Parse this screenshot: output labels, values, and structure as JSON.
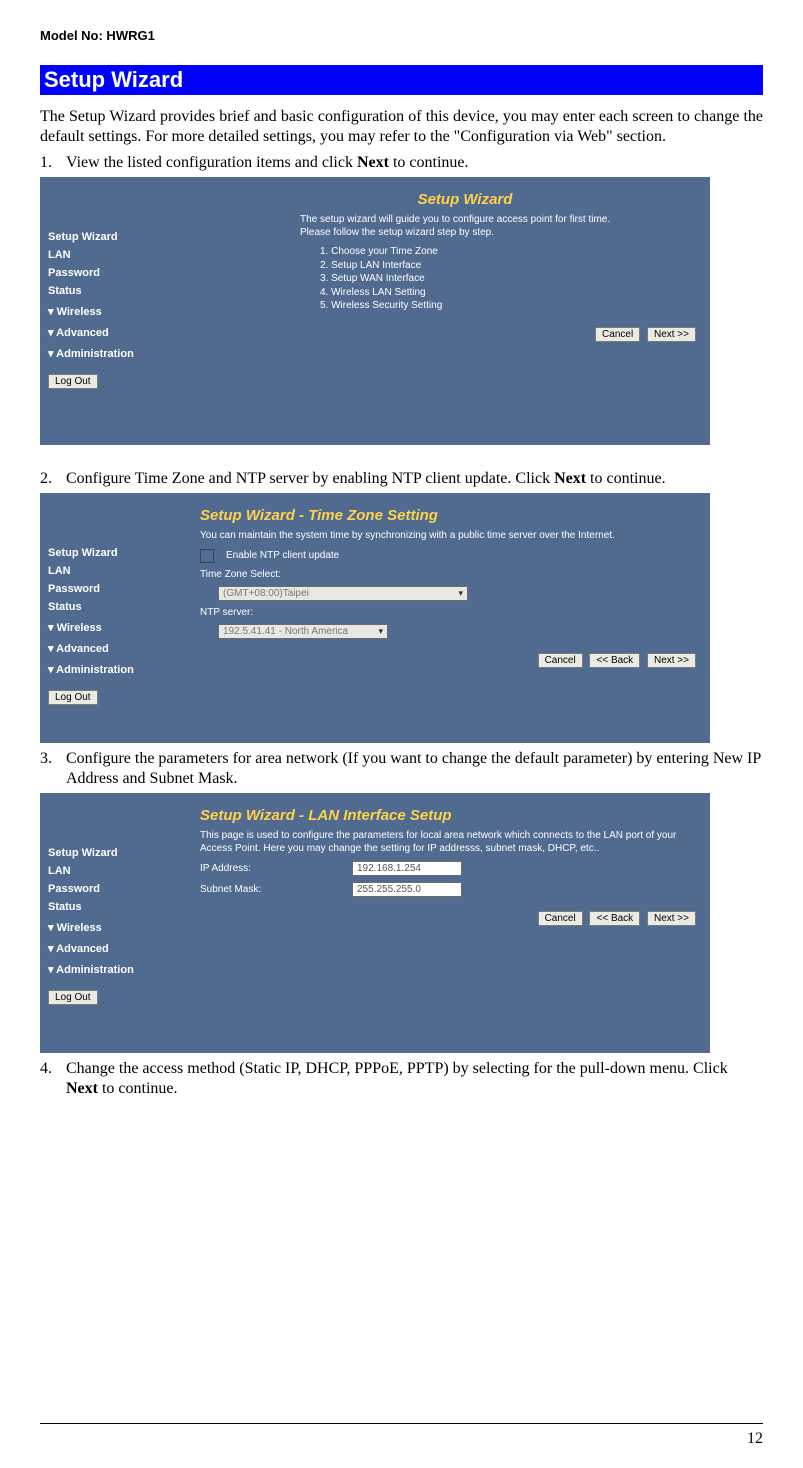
{
  "header": {
    "model": "Model No: HWRG1"
  },
  "banner": "Setup Wizard",
  "intro": "The Setup Wizard provides brief and basic configuration of this device, you may enter each screen to change the default settings.  For more detailed settings, you may refer to the \"Configuration via Web\" section.",
  "items": {
    "1": {
      "num": "1.",
      "pre": "View the listed configuration items and click ",
      "bold": "Next",
      "post": " to continue."
    },
    "2": {
      "num": "2.",
      "pre": "Configure Time Zone and NTP server by enabling NTP client update. Click ",
      "bold": "Next",
      "post": " to continue."
    },
    "3": {
      "num": "3.",
      "text": "Configure the parameters for area network (If you want to change the default parameter) by entering New IP Address and Subnet Mask."
    },
    "4": {
      "num": "4.",
      "pre": "Change the access method (Static IP, DHCP, PPPoE, PPTP) by selecting for the pull-down menu. Click ",
      "bold": "Next",
      "post": " to continue."
    }
  },
  "sidebar": {
    "items": [
      "Setup Wizard",
      "LAN",
      "Password",
      "Status"
    ],
    "groups": [
      "Wireless",
      "Advanced",
      "Administration"
    ],
    "logout": "Log Out"
  },
  "shot1": {
    "title": "Setup Wizard",
    "desc1": "The setup wizard will guide you to configure access point for first time.",
    "desc2": "Please follow the setup wizard step by step.",
    "steps": [
      "1.   Choose your Time Zone",
      "2.   Setup LAN Interface",
      "3.   Setup WAN Interface",
      "4.   Wireless LAN Setting",
      "5.   Wireless Security Setting"
    ],
    "cancel": "Cancel",
    "next": "Next >>"
  },
  "shot2": {
    "title": "Setup Wizard - Time Zone Setting",
    "desc": "You can maintain the system time by synchronizing with a public time server over the Internet.",
    "enable": "Enable NTP client update",
    "tz_label": "Time Zone Select:",
    "tz_value": "(GMT+08:00)Taipei",
    "ntp_label": "NTP server:",
    "ntp_value": "192.5.41.41 - North America",
    "cancel": "Cancel",
    "back": "<< Back",
    "next": "Next >>"
  },
  "shot3": {
    "title": "Setup Wizard - LAN Interface Setup",
    "desc": "This page is used to configure the parameters for local area network which connects to the LAN port of your Access Point. Here you may change the setting for IP addresss, subnet mask, DHCP, etc..",
    "ip_label": "IP Address:",
    "ip_value": "192.168.1.254",
    "mask_label": "Subnet Mask:",
    "mask_value": "255.255.255.0",
    "cancel": "Cancel",
    "back": "<< Back",
    "next": "Next >>"
  },
  "page_no": "12"
}
